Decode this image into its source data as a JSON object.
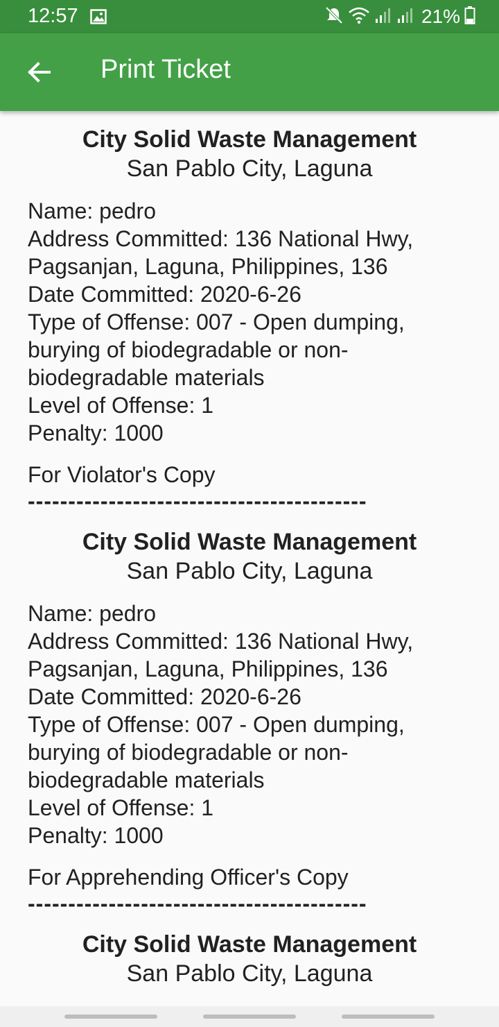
{
  "status_bar": {
    "time": "12:57",
    "battery": "21%",
    "icons": [
      "gallery-icon",
      "mute-icon",
      "wifi-icon",
      "signal-icon",
      "signal-icon",
      "battery-icon"
    ]
  },
  "app_bar": {
    "title": "Print Ticket",
    "back_icon": "arrow-back-icon"
  },
  "tickets": [
    {
      "org_name": "City Solid Waste Management",
      "org_city": "San Pablo City, Laguna",
      "name": "Name: pedro",
      "address": "Address Committed: 136 National Hwy, Pagsanjan, Laguna, Philippines, 136",
      "date": "Date Committed: 2020-6-26",
      "offense_type": "Type of Offense: 007 - Open dumping, burying of biodegradable or non-biodegradable materials",
      "offense_level": "Level of Offense: 1",
      "penalty": "Penalty: 1000",
      "copy_label": "For Violator's Copy",
      "divider": "------------------------------------------"
    },
    {
      "org_name": "City Solid Waste Management",
      "org_city": "San Pablo City, Laguna",
      "name": "Name: pedro",
      "address": "Address Committed: 136 National Hwy, Pagsanjan, Laguna, Philippines, 136",
      "date": "Date Committed: 2020-6-26",
      "offense_type": "Type of Offense: 007 - Open dumping, burying of biodegradable or non-biodegradable materials",
      "offense_level": "Level of Offense: 1",
      "penalty": "Penalty: 1000",
      "copy_label": "For Apprehending Officer's Copy",
      "divider": "------------------------------------------"
    },
    {
      "org_name": "City Solid Waste Management",
      "org_city": "San Pablo City, Laguna"
    }
  ],
  "colors": {
    "status_bar": "#388e3c",
    "app_bar": "#43a047",
    "background": "#fafafa",
    "text": "#212121"
  }
}
